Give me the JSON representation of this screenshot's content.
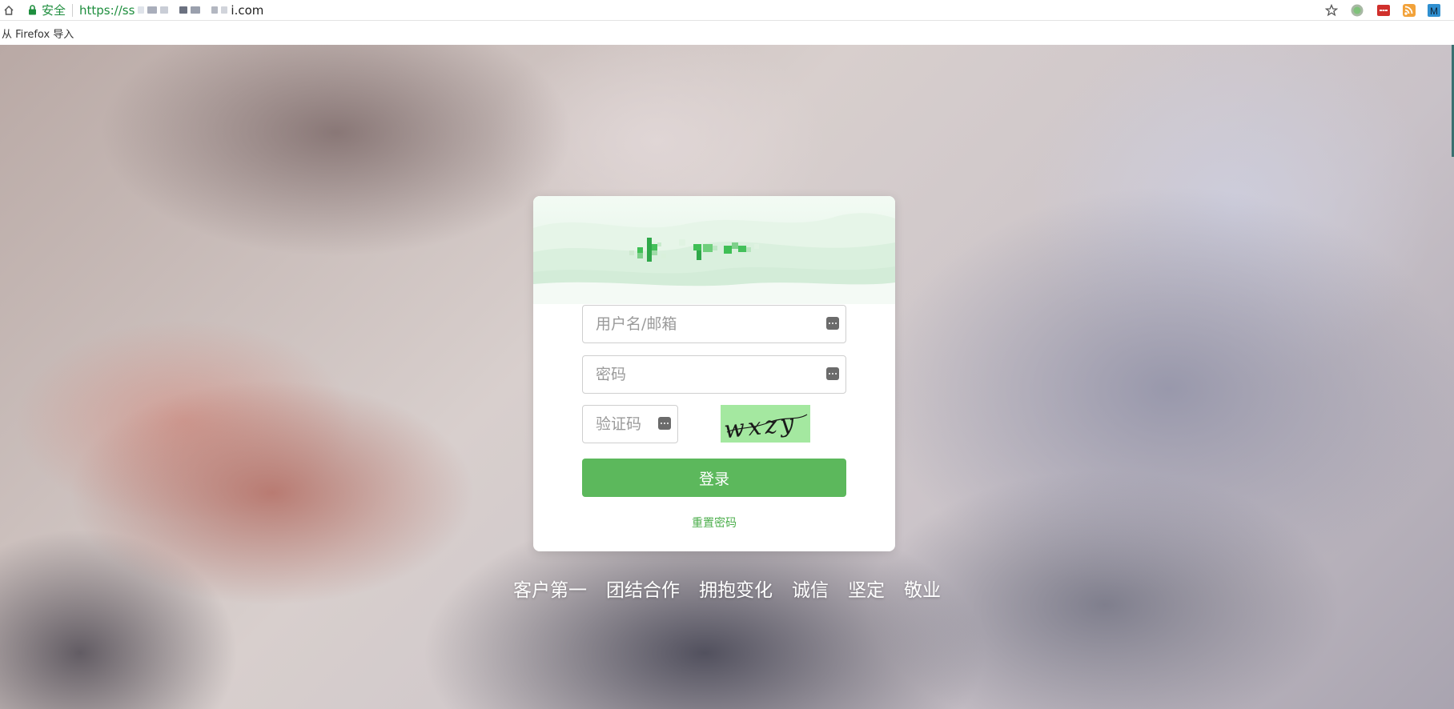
{
  "browser": {
    "secure_label": "安全",
    "url_prefix": "https://ss",
    "url_suffix": "i.com",
    "bookmarks": [
      {
        "label": "从 Firefox 导入"
      }
    ]
  },
  "colors": {
    "accent": "#5cb85c",
    "link": "#4cae4c",
    "captcha_bg": "#a4e8a0",
    "secure": "#1e8e3e"
  },
  "login": {
    "username_placeholder": "用户名/邮箱",
    "password_placeholder": "密码",
    "captcha_placeholder": "验证码",
    "captcha_text": "wxzy",
    "login_label": "登录",
    "reset_label": "重置密码"
  },
  "slogan": [
    "客户第一",
    "团结合作",
    "拥抱变化",
    "诚信",
    "坚定",
    "敬业"
  ]
}
